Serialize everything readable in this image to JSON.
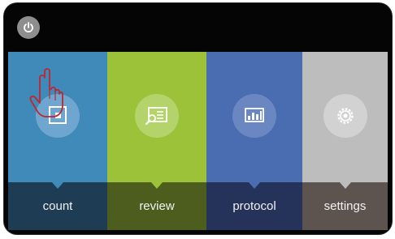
{
  "power": {
    "icon": "power-icon"
  },
  "tiles": [
    {
      "id": "count",
      "label": "count",
      "icon": "count-icon"
    },
    {
      "id": "review",
      "label": "review",
      "icon": "review-icon"
    },
    {
      "id": "protocol",
      "label": "protocol",
      "icon": "chart-icon"
    },
    {
      "id": "settings",
      "label": "settings",
      "icon": "gear-icon"
    }
  ],
  "colors": {
    "count": "#3f8ab9",
    "review": "#9cc23a",
    "protocol": "#4a6cb0",
    "settings": "#bdbdbd",
    "hand_outline": "#c0262d"
  },
  "pointer": {
    "icon": "hand-pointer-icon",
    "target": "count"
  }
}
